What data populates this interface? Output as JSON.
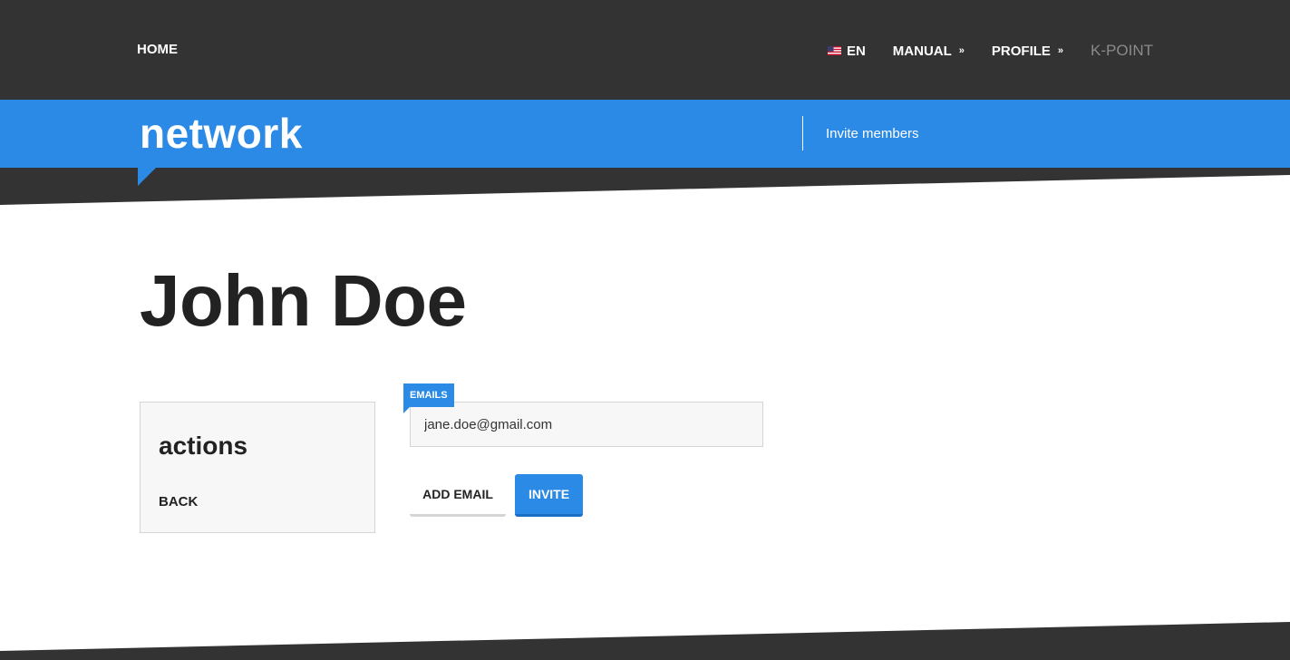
{
  "nav": {
    "home": "HOME",
    "language": "EN",
    "manual": "MANUAL",
    "profile": "PROFILE",
    "brand": "K-POINT"
  },
  "section": {
    "title": "network",
    "subnav": "Invite members"
  },
  "page": {
    "title": "John Doe"
  },
  "actions": {
    "title": "actions",
    "back": "BACK"
  },
  "form": {
    "field_label": "EMAILS",
    "email_value": "jane.doe@gmail.com",
    "add_email": "ADD EMAIL",
    "invite": "INVITE"
  },
  "colors": {
    "accent": "#2b8ae6",
    "dark": "#333333"
  },
  "icons": {
    "flag": "us-flag-icon",
    "chevron": "double-chevron-down-icon"
  }
}
